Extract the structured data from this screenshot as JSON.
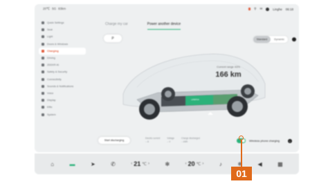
{
  "status": {
    "time_left": "20℃",
    "signal": "5G",
    "battery_pct": "83km",
    "time_right": "06:18",
    "user_label": "Linghe"
  },
  "sidebar": {
    "items": [
      {
        "label": "Quick Settings",
        "icon": "grid-icon"
      },
      {
        "label": "Seat",
        "icon": "seat-icon"
      },
      {
        "label": "Light",
        "icon": "light-icon"
      },
      {
        "label": "Doors & Windows",
        "icon": "door-icon"
      },
      {
        "label": "Charging",
        "icon": "charging-icon",
        "active": true
      },
      {
        "label": "Driving",
        "icon": "steering-icon"
      },
      {
        "label": "ZEEKR AI",
        "icon": "ai-icon"
      },
      {
        "label": "Safety & Security",
        "icon": "shield-icon"
      },
      {
        "label": "Connectivity",
        "icon": "wifi-icon"
      },
      {
        "label": "Sounds & Notifications",
        "icon": "sound-icon"
      },
      {
        "label": "Voice",
        "icon": "mic-icon"
      },
      {
        "label": "Display",
        "icon": "display-icon"
      },
      {
        "label": "Efits",
        "icon": "efits-icon"
      },
      {
        "label": "System",
        "icon": "system-icon"
      }
    ]
  },
  "tabs": [
    {
      "label": "Charge my car",
      "active": false
    },
    {
      "label": "Power another device",
      "active": true
    }
  ],
  "mode_pill": {
    "label": "P"
  },
  "mode_segment": {
    "options": [
      {
        "label": "Standard",
        "selected": true
      },
      {
        "label": "Dynamic",
        "selected": false
      }
    ]
  },
  "car": {
    "range_label": "Current range 43%",
    "range_value": "166 km",
    "battery_badge": "LIFEPO4"
  },
  "controls": {
    "start_button": "Start discharging",
    "meta": [
      {
        "label": "Electric current",
        "value": "-- A"
      },
      {
        "label": "Voltage",
        "value": "-- V"
      },
      {
        "label": "Charge discharged",
        "value": "-- kWh"
      }
    ],
    "wireless_label": "Wireless phone charging",
    "wireless_on": true
  },
  "dock": {
    "temp_left": "21",
    "temp_left_unit": "℃",
    "temp_right": "20",
    "temp_right_unit": "℃"
  },
  "callout": {
    "label": "01"
  },
  "colors": {
    "accent_green": "#2bb27a",
    "accent_orange": "#e06a1a",
    "active_red": "#e05a3a"
  }
}
